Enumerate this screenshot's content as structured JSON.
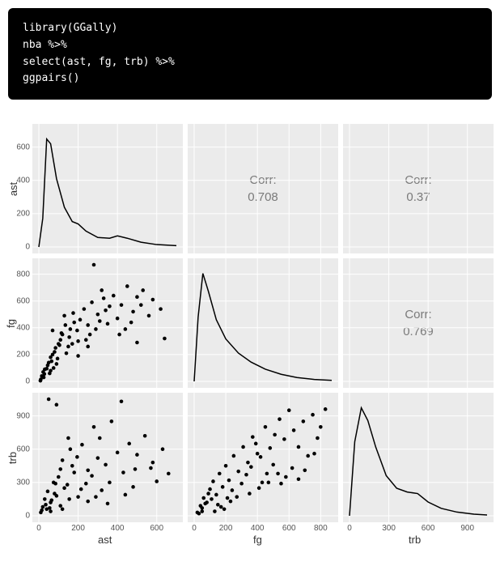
{
  "code": {
    "line1": "library(GGally)",
    "line2": "nba %>%",
    "line3": "select(ast, fg, trb) %>%",
    "line4": "ggpairs()"
  },
  "vars": [
    "ast",
    "fg",
    "trb"
  ],
  "corr_label": "Corr:",
  "chart_data": {
    "type": "pairs_matrix",
    "variables": [
      "ast",
      "fg",
      "trb"
    ],
    "ranges": {
      "ast": [
        0,
        700
      ],
      "fg": [
        0,
        870
      ],
      "trb": [
        0,
        1050
      ]
    },
    "ticks": {
      "ast_y": [
        0,
        200,
        400,
        600
      ],
      "fg_y": [
        0,
        200,
        400,
        600,
        800
      ],
      "trb_y": [
        0,
        300,
        600,
        900
      ],
      "ast_x": [
        0,
        200,
        400,
        600
      ],
      "fg_x": [
        0,
        200,
        400,
        600,
        800
      ],
      "trb_x": [
        0,
        300,
        600,
        900
      ]
    },
    "correlations": {
      "ast_fg": 0.708,
      "ast_trb": 0.37,
      "fg_trb": 0.769
    },
    "densities": {
      "ast": [
        [
          0,
          0
        ],
        [
          20,
          180
        ],
        [
          40,
          680
        ],
        [
          60,
          650
        ],
        [
          90,
          430
        ],
        [
          130,
          250
        ],
        [
          170,
          160
        ],
        [
          200,
          145
        ],
        [
          240,
          100
        ],
        [
          300,
          60
        ],
        [
          360,
          55
        ],
        [
          400,
          70
        ],
        [
          450,
          55
        ],
        [
          520,
          30
        ],
        [
          600,
          15
        ],
        [
          700,
          8
        ]
      ],
      "fg": [
        [
          0,
          0
        ],
        [
          25,
          500
        ],
        [
          55,
          840
        ],
        [
          90,
          700
        ],
        [
          140,
          480
        ],
        [
          200,
          330
        ],
        [
          280,
          220
        ],
        [
          360,
          150
        ],
        [
          450,
          95
        ],
        [
          550,
          55
        ],
        [
          650,
          30
        ],
        [
          760,
          15
        ],
        [
          870,
          8
        ]
      ],
      "trb": [
        [
          0,
          0
        ],
        [
          40,
          700
        ],
        [
          90,
          1020
        ],
        [
          140,
          900
        ],
        [
          200,
          650
        ],
        [
          280,
          380
        ],
        [
          360,
          260
        ],
        [
          440,
          225
        ],
        [
          520,
          210
        ],
        [
          600,
          130
        ],
        [
          700,
          70
        ],
        [
          820,
          35
        ],
        [
          950,
          15
        ],
        [
          1050,
          8
        ]
      ]
    },
    "scatter": {
      "fg_vs_ast": [
        [
          10,
          15
        ],
        [
          15,
          40
        ],
        [
          22,
          70
        ],
        [
          8,
          5
        ],
        [
          30,
          90
        ],
        [
          45,
          120
        ],
        [
          60,
          180
        ],
        [
          28,
          55
        ],
        [
          50,
          140
        ],
        [
          70,
          200
        ],
        [
          85,
          250
        ],
        [
          95,
          170
        ],
        [
          110,
          310
        ],
        [
          25,
          30
        ],
        [
          40,
          95
        ],
        [
          55,
          60
        ],
        [
          65,
          150
        ],
        [
          80,
          220
        ],
        [
          100,
          280
        ],
        [
          120,
          350
        ],
        [
          140,
          210
        ],
        [
          160,
          390
        ],
        [
          180,
          440
        ],
        [
          200,
          300
        ],
        [
          150,
          260
        ],
        [
          130,
          490
        ],
        [
          115,
          360
        ],
        [
          90,
          130
        ],
        [
          75,
          100
        ],
        [
          60,
          80
        ],
        [
          105,
          270
        ],
        [
          135,
          420
        ],
        [
          155,
          330
        ],
        [
          175,
          510
        ],
        [
          195,
          380
        ],
        [
          210,
          460
        ],
        [
          230,
          540
        ],
        [
          250,
          420
        ],
        [
          270,
          590
        ],
        [
          300,
          500
        ],
        [
          330,
          620
        ],
        [
          290,
          390
        ],
        [
          260,
          350
        ],
        [
          320,
          680
        ],
        [
          360,
          560
        ],
        [
          400,
          470
        ],
        [
          350,
          430
        ],
        [
          380,
          640
        ],
        [
          420,
          570
        ],
        [
          450,
          710
        ],
        [
          480,
          520
        ],
        [
          440,
          390
        ],
        [
          410,
          350
        ],
        [
          500,
          630
        ],
        [
          530,
          680
        ],
        [
          560,
          490
        ],
        [
          470,
          440
        ],
        [
          520,
          570
        ],
        [
          580,
          610
        ],
        [
          620,
          540
        ],
        [
          280,
          870
        ],
        [
          250,
          260
        ],
        [
          70,
          380
        ],
        [
          640,
          320
        ],
        [
          500,
          290
        ],
        [
          200,
          190
        ],
        [
          240,
          310
        ],
        [
          310,
          450
        ],
        [
          340,
          530
        ],
        [
          170,
          280
        ]
      ],
      "trb_vs_ast": [
        [
          10,
          30
        ],
        [
          20,
          80
        ],
        [
          30,
          150
        ],
        [
          45,
          220
        ],
        [
          60,
          120
        ],
        [
          75,
          300
        ],
        [
          90,
          180
        ],
        [
          110,
          420
        ],
        [
          130,
          250
        ],
        [
          15,
          50
        ],
        [
          35,
          100
        ],
        [
          55,
          70
        ],
        [
          80,
          200
        ],
        [
          100,
          350
        ],
        [
          120,
          500
        ],
        [
          145,
          280
        ],
        [
          160,
          600
        ],
        [
          180,
          390
        ],
        [
          200,
          170
        ],
        [
          170,
          450
        ],
        [
          150,
          700
        ],
        [
          195,
          530
        ],
        [
          220,
          640
        ],
        [
          250,
          410
        ],
        [
          280,
          800
        ],
        [
          300,
          520
        ],
        [
          270,
          360
        ],
        [
          240,
          290
        ],
        [
          110,
          90
        ],
        [
          65,
          140
        ],
        [
          310,
          700
        ],
        [
          340,
          460
        ],
        [
          370,
          850
        ],
        [
          400,
          570
        ],
        [
          430,
          390
        ],
        [
          460,
          650
        ],
        [
          490,
          420
        ],
        [
          360,
          300
        ],
        [
          320,
          230
        ],
        [
          290,
          170
        ],
        [
          500,
          550
        ],
        [
          540,
          720
        ],
        [
          570,
          430
        ],
        [
          600,
          310
        ],
        [
          480,
          260
        ],
        [
          440,
          190
        ],
        [
          580,
          480
        ],
        [
          630,
          600
        ],
        [
          660,
          380
        ],
        [
          50,
          1050
        ],
        [
          90,
          1000
        ],
        [
          250,
          130
        ],
        [
          60,
          40
        ],
        [
          420,
          1030
        ],
        [
          350,
          110
        ],
        [
          120,
          60
        ],
        [
          85,
          290
        ],
        [
          40,
          60
        ],
        [
          155,
          150
        ],
        [
          215,
          240
        ]
      ],
      "trb_vs_fg": [
        [
          20,
          30
        ],
        [
          40,
          90
        ],
        [
          60,
          160
        ],
        [
          80,
          120
        ],
        [
          100,
          240
        ],
        [
          50,
          70
        ],
        [
          70,
          110
        ],
        [
          90,
          200
        ],
        [
          120,
          310
        ],
        [
          140,
          190
        ],
        [
          160,
          380
        ],
        [
          180,
          260
        ],
        [
          200,
          450
        ],
        [
          220,
          320
        ],
        [
          250,
          540
        ],
        [
          280,
          400
        ],
        [
          310,
          620
        ],
        [
          340,
          480
        ],
        [
          370,
          710
        ],
        [
          400,
          560
        ],
        [
          240,
          230
        ],
        [
          270,
          170
        ],
        [
          300,
          290
        ],
        [
          330,
          370
        ],
        [
          360,
          440
        ],
        [
          390,
          650
        ],
        [
          420,
          530
        ],
        [
          450,
          800
        ],
        [
          480,
          610
        ],
        [
          510,
          730
        ],
        [
          540,
          870
        ],
        [
          570,
          690
        ],
        [
          600,
          950
        ],
        [
          500,
          460
        ],
        [
          460,
          380
        ],
        [
          430,
          300
        ],
        [
          630,
          770
        ],
        [
          660,
          620
        ],
        [
          690,
          850
        ],
        [
          720,
          540
        ],
        [
          750,
          910
        ],
        [
          780,
          700
        ],
        [
          620,
          430
        ],
        [
          580,
          350
        ],
        [
          550,
          290
        ],
        [
          800,
          800
        ],
        [
          830,
          960
        ],
        [
          760,
          560
        ],
        [
          700,
          410
        ],
        [
          660,
          330
        ],
        [
          110,
          150
        ],
        [
          150,
          100
        ],
        [
          190,
          60
        ],
        [
          230,
          130
        ],
        [
          130,
          40
        ],
        [
          170,
          80
        ],
        [
          210,
          160
        ],
        [
          50,
          40
        ],
        [
          30,
          20
        ],
        [
          350,
          200
        ],
        [
          410,
          250
        ],
        [
          470,
          300
        ],
        [
          530,
          380
        ]
      ]
    }
  }
}
